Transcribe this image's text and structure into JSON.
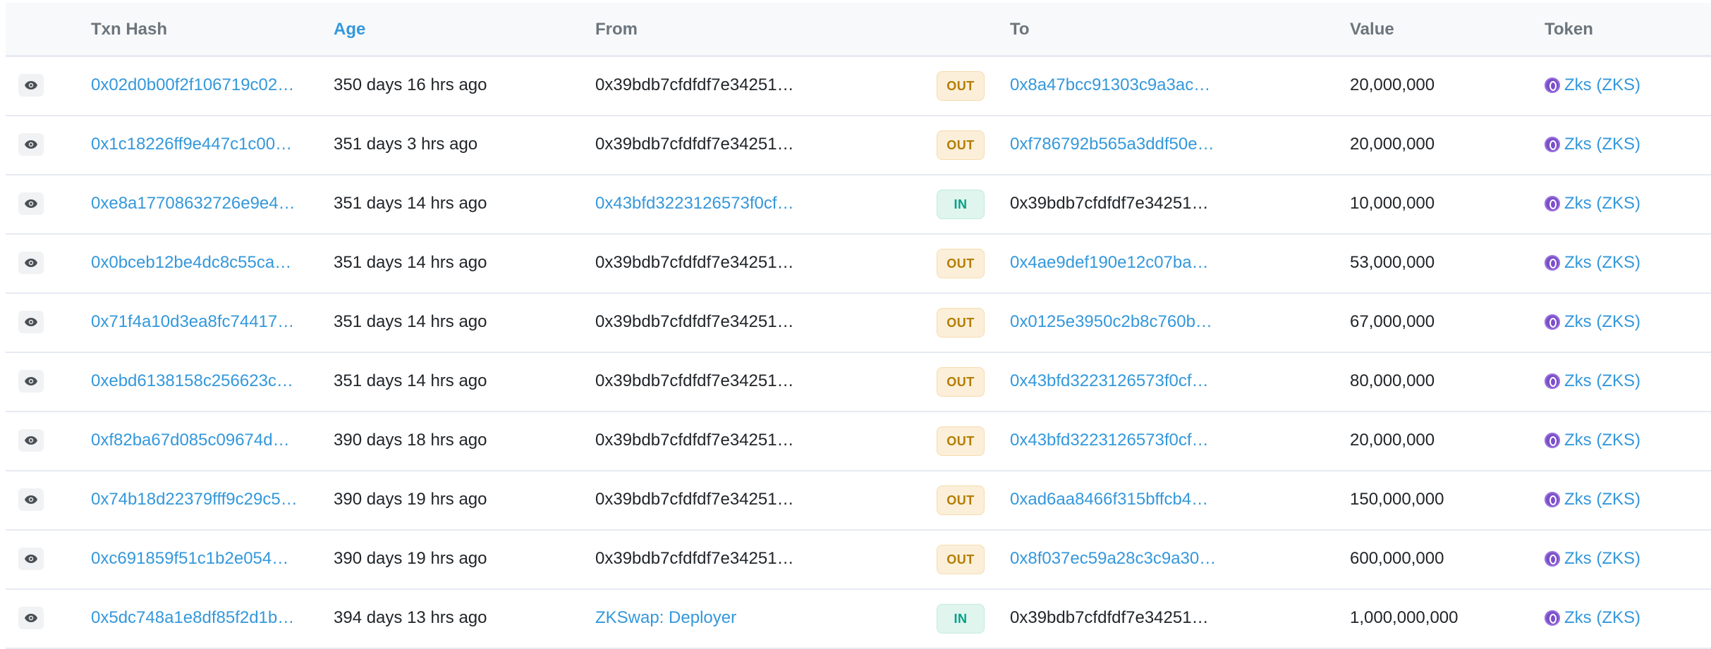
{
  "colors": {
    "link": "#3498db",
    "out_bg": "#fbefd9",
    "out_text": "#b47d00",
    "in_bg": "#dff5ee",
    "in_text": "#00a186",
    "token_icon": "#7b4fc9"
  },
  "table": {
    "headers": {
      "txn_hash": "Txn Hash",
      "age": "Age",
      "from": "From",
      "to": "To",
      "value": "Value",
      "token": "Token"
    },
    "rows": [
      {
        "hash": "0x02d0b00f2f106719c02…",
        "age": "350 days 16 hrs ago",
        "from": "0x39bdb7cfdfdf7e34251…",
        "from_link": false,
        "direction": "OUT",
        "to": "0x8a47bcc91303c9a3ac…",
        "to_link": true,
        "value": "20,000,000",
        "token": "Zks (ZKS)"
      },
      {
        "hash": "0x1c18226ff9e447c1c00…",
        "age": "351 days 3 hrs ago",
        "from": "0x39bdb7cfdfdf7e34251…",
        "from_link": false,
        "direction": "OUT",
        "to": "0xf786792b565a3ddf50e…",
        "to_link": true,
        "value": "20,000,000",
        "token": "Zks (ZKS)"
      },
      {
        "hash": "0xe8a17708632726e9e4…",
        "age": "351 days 14 hrs ago",
        "from": "0x43bfd3223126573f0cf…",
        "from_link": true,
        "direction": "IN",
        "to": "0x39bdb7cfdfdf7e34251…",
        "to_link": false,
        "value": "10,000,000",
        "token": "Zks (ZKS)"
      },
      {
        "hash": "0x0bceb12be4dc8c55ca…",
        "age": "351 days 14 hrs ago",
        "from": "0x39bdb7cfdfdf7e34251…",
        "from_link": false,
        "direction": "OUT",
        "to": "0x4ae9def190e12c07ba…",
        "to_link": true,
        "value": "53,000,000",
        "token": "Zks (ZKS)"
      },
      {
        "hash": "0x71f4a10d3ea8fc74417…",
        "age": "351 days 14 hrs ago",
        "from": "0x39bdb7cfdfdf7e34251…",
        "from_link": false,
        "direction": "OUT",
        "to": "0x0125e3950c2b8c760b…",
        "to_link": true,
        "value": "67,000,000",
        "token": "Zks (ZKS)"
      },
      {
        "hash": "0xebd6138158c256623c…",
        "age": "351 days 14 hrs ago",
        "from": "0x39bdb7cfdfdf7e34251…",
        "from_link": false,
        "direction": "OUT",
        "to": "0x43bfd3223126573f0cf…",
        "to_link": true,
        "value": "80,000,000",
        "token": "Zks (ZKS)"
      },
      {
        "hash": "0xf82ba67d085c09674d…",
        "age": "390 days 18 hrs ago",
        "from": "0x39bdb7cfdfdf7e34251…",
        "from_link": false,
        "direction": "OUT",
        "to": "0x43bfd3223126573f0cf…",
        "to_link": true,
        "value": "20,000,000",
        "token": "Zks (ZKS)"
      },
      {
        "hash": "0x74b18d22379fff9c29c5…",
        "age": "390 days 19 hrs ago",
        "from": "0x39bdb7cfdfdf7e34251…",
        "from_link": false,
        "direction": "OUT",
        "to": "0xad6aa8466f315bffcb4…",
        "to_link": true,
        "value": "150,000,000",
        "token": "Zks (ZKS)"
      },
      {
        "hash": "0xc691859f51c1b2e054…",
        "age": "390 days 19 hrs ago",
        "from": "0x39bdb7cfdfdf7e34251…",
        "from_link": false,
        "direction": "OUT",
        "to": "0x8f037ec59a28c3c9a30…",
        "to_link": true,
        "value": "600,000,000",
        "token": "Zks (ZKS)"
      },
      {
        "hash": "0x5dc748a1e8df85f2d1b…",
        "age": "394 days 13 hrs ago",
        "from": "ZKSwap: Deployer",
        "from_link": true,
        "direction": "IN",
        "to": "0x39bdb7cfdfdf7e34251…",
        "to_link": false,
        "value": "1,000,000,000",
        "token": "Zks (ZKS)"
      }
    ]
  }
}
